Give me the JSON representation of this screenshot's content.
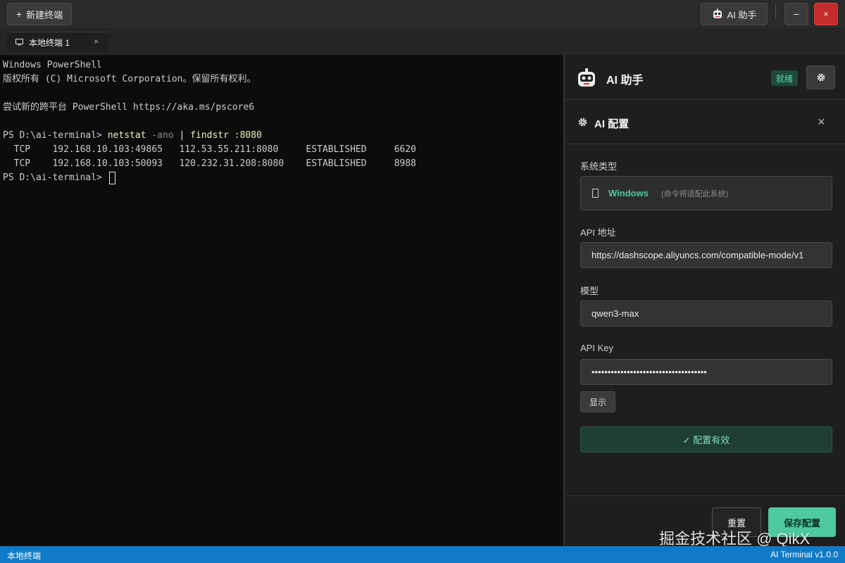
{
  "titlebar": {
    "new_terminal_label": "新建终端",
    "ai_button_label": "AI 助手",
    "minimize_label": "−",
    "close_label": "×"
  },
  "tabs": [
    {
      "label": "本地终端 1",
      "close": "×"
    }
  ],
  "terminal": {
    "lines": [
      "Windows PowerShell",
      "版权所有 (C) Microsoft Corporation。保留所有权利。",
      "",
      "尝试新的跨平台 PowerShell https://aka.ms/pscore6",
      ""
    ],
    "command": {
      "prompt": "PS D:\\ai-terminal> ",
      "cmd": "netstat",
      "flag": " -ano",
      "rest": " | findstr :8080"
    },
    "output": [
      "  TCP    192.168.10.103:49865   112.53.55.211:8080     ESTABLISHED     6620",
      "  TCP    192.168.10.103:50093   120.232.31.208:8080    ESTABLISHED     8988"
    ],
    "final_prompt": "PS D:\\ai-terminal> "
  },
  "panel": {
    "title": "AI 助手",
    "status": "就绪",
    "config_title": "AI 配置",
    "close": "×",
    "system_type_label": "系统类型",
    "system_name": "Windows",
    "system_hint": "(命令将适配此系统)",
    "api_url_label": "API 地址",
    "api_url_value": "https://dashscope.aliyuncs.com/compatible-mode/v1",
    "model_label": "模型",
    "model_value": "qwen3-max",
    "api_key_label": "API Key",
    "api_key_value": "••••••••••••••••••••••••••••••••••••",
    "show_label": "显示",
    "valid_text": "✓ 配置有效",
    "reset_label": "重置",
    "save_label": "保存配置"
  },
  "watermark": "掘金技术社区 @ QikX",
  "statusbar": {
    "left": "本地终端",
    "right": "AI Terminal v1.0.0"
  },
  "colors": {
    "accent": "#4ec9a0",
    "status_bar": "#0e7ac8",
    "close": "#c42b2b"
  }
}
